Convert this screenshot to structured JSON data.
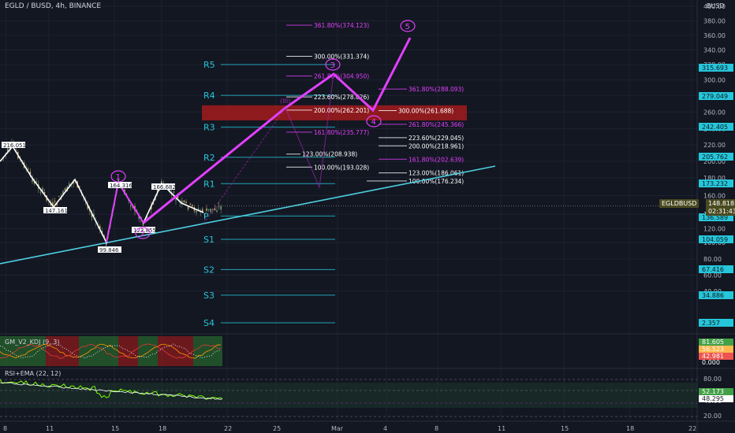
{
  "header": {
    "title": "EGLD / BUSD, 4h, BINANCE",
    "currency": "BUSD"
  },
  "symbol_tag": "EGLDBUSD",
  "price_tag": "148.818",
  "countdown_tag": "02:31:43",
  "indicators": {
    "kdj_label": "GM_V2_KDJ (9, 3)",
    "rsi_label": "RSI+EMA (22, 12)"
  },
  "colors": {
    "background": "#131722",
    "wave": "#e040fb",
    "trendline": "#4dd0e1",
    "pivot": "#26c6da",
    "candle_up": "#a5d6a7",
    "candle_down": "#ffe082",
    "zone": "#b71c1c"
  },
  "chart_data": {
    "type": "line",
    "title": "EGLD / BUSD, 4h, BINANCE",
    "ylabel": "BUSD",
    "y_scale": "log",
    "yticks": [
      "40.00",
      "60.00",
      "80.00",
      "100.00",
      "120.00",
      "140.00",
      "160.00",
      "180.00",
      "200.00",
      "220.00",
      "240.00",
      "260.00",
      "280.00",
      "300.00",
      "320.00",
      "340.00",
      "360.00",
      "380.00",
      "400.00"
    ],
    "xticks": [
      "8",
      "11",
      "15",
      "18",
      "22",
      "25",
      "Mar",
      "4",
      "8",
      "11",
      "15",
      "18",
      "22"
    ],
    "price_path": [
      {
        "x": "8",
        "y": 200
      },
      {
        "x": "9",
        "y": 216.051
      },
      {
        "x": "10",
        "y": 170
      },
      {
        "x": "11",
        "y": 147.161
      },
      {
        "x": "12",
        "y": 175
      },
      {
        "x": "14",
        "y": 100
      },
      {
        "x": "15",
        "y": 164.316
      },
      {
        "x": "16",
        "y": 123.855
      },
      {
        "x": "17",
        "y": 166.682
      },
      {
        "x": "18",
        "y": 158
      },
      {
        "x": "19",
        "y": 145
      },
      {
        "x": "20",
        "y": 148.818
      }
    ],
    "price_labels": [
      {
        "label": "216.051",
        "y": 216.051
      },
      {
        "label": "147.161",
        "y": 147.161
      },
      {
        "label": "99.846",
        "y": 99.846
      },
      {
        "label": "164.316",
        "y": 164.316
      },
      {
        "label": "123.855",
        "y": 123.855
      },
      {
        "label": "166.682",
        "y": 166.682
      }
    ],
    "wave_labels": [
      "1",
      "2",
      "(III)",
      "3",
      "4",
      "5"
    ],
    "projected_wave": [
      {
        "x": "19",
        "y": 123.855
      },
      {
        "x": "26",
        "y": 262.201
      },
      {
        "x": "28",
        "y": 304.95
      },
      {
        "x": "Mar3",
        "y": 261.688
      },
      {
        "x": "Mar7",
        "y": 374.123
      }
    ],
    "pivot_levels": [
      {
        "name": "R5",
        "value": 320
      },
      {
        "name": "R4",
        "value": 280
      },
      {
        "name": "R3",
        "value": 242
      },
      {
        "name": "R2",
        "value": 205
      },
      {
        "name": "R1",
        "value": 173
      },
      {
        "name": "P",
        "value": 138
      },
      {
        "name": "S1",
        "value": 104
      },
      {
        "name": "S2",
        "value": 67
      },
      {
        "name": "S3",
        "value": 35
      },
      {
        "name": "S4",
        "value": 2.357
      }
    ],
    "fib_levels": [
      {
        "label": "361.80%(374.123)",
        "value": 374.123,
        "group": "magenta"
      },
      {
        "label": "300.00%(331.374)",
        "value": 331.374,
        "group": "white"
      },
      {
        "label": "261.80%(304.950)",
        "value": 304.95,
        "group": "magenta"
      },
      {
        "label": "361.80%(288.093)",
        "value": 288.093,
        "group": "magenta"
      },
      {
        "label": "223.60%(278.026)",
        "value": 278.026,
        "group": "white"
      },
      {
        "label": "200.00%(262.201)",
        "value": 262.201,
        "group": "white"
      },
      {
        "label": "300.00%(261.688)",
        "value": 261.688,
        "group": "white"
      },
      {
        "label": "261.80%(245.366)",
        "value": 245.366,
        "group": "magenta"
      },
      {
        "label": "161.80%(235.777)",
        "value": 235.777,
        "group": "magenta"
      },
      {
        "label": "223.60%(229.045)",
        "value": 229.045,
        "group": "white"
      },
      {
        "label": "200.00%(218.961)",
        "value": 218.961,
        "group": "white"
      },
      {
        "label": "123.00%(208.938)",
        "value": 208.938,
        "group": "white"
      },
      {
        "label": "161.80%(202.639)",
        "value": 202.639,
        "group": "magenta"
      },
      {
        "label": "100.00%(193.028)",
        "value": 193.028,
        "group": "white"
      },
      {
        "label": "123.00%(186.061)",
        "value": 186.061,
        "group": "white"
      },
      {
        "label": "100.00%(176.234)",
        "value": 176.234,
        "group": "white"
      }
    ],
    "axis_tags": [
      {
        "label": "315.693",
        "value": 315.693,
        "color": "#26c6da"
      },
      {
        "label": "279.049",
        "value": 279.049,
        "color": "#26c6da"
      },
      {
        "label": "242.405",
        "value": 242.405,
        "color": "#26c6da"
      },
      {
        "label": "205.762",
        "value": 205.762,
        "color": "#26c6da"
      },
      {
        "label": "173.232",
        "value": 173.232,
        "color": "#26c6da"
      },
      {
        "label": "136.589",
        "value": 136.589,
        "color": "#26c6da"
      },
      {
        "label": "104.059",
        "value": 104.059,
        "color": "#26c6da"
      },
      {
        "label": "67.416",
        "value": 67.416,
        "color": "#26c6da"
      },
      {
        "label": "34.886",
        "value": 34.886,
        "color": "#26c6da"
      },
      {
        "label": "2.357",
        "value": 2.357,
        "color": "#26c6da"
      }
    ],
    "kdj_tags": [
      {
        "label": "81.605",
        "color": "#43a047"
      },
      {
        "label": "56.523",
        "color": "#ffb74d"
      },
      {
        "label": "42.981",
        "color": "#ef5350"
      },
      {
        "label": "0.000",
        "color": "none"
      }
    ],
    "rsi_ticks": [
      "80.00",
      "40.00",
      "20.00"
    ],
    "rsi_tags": [
      {
        "label": "52.173",
        "color": "#43a047"
      },
      {
        "label": "48.295",
        "color": "#ffffff"
      }
    ]
  }
}
